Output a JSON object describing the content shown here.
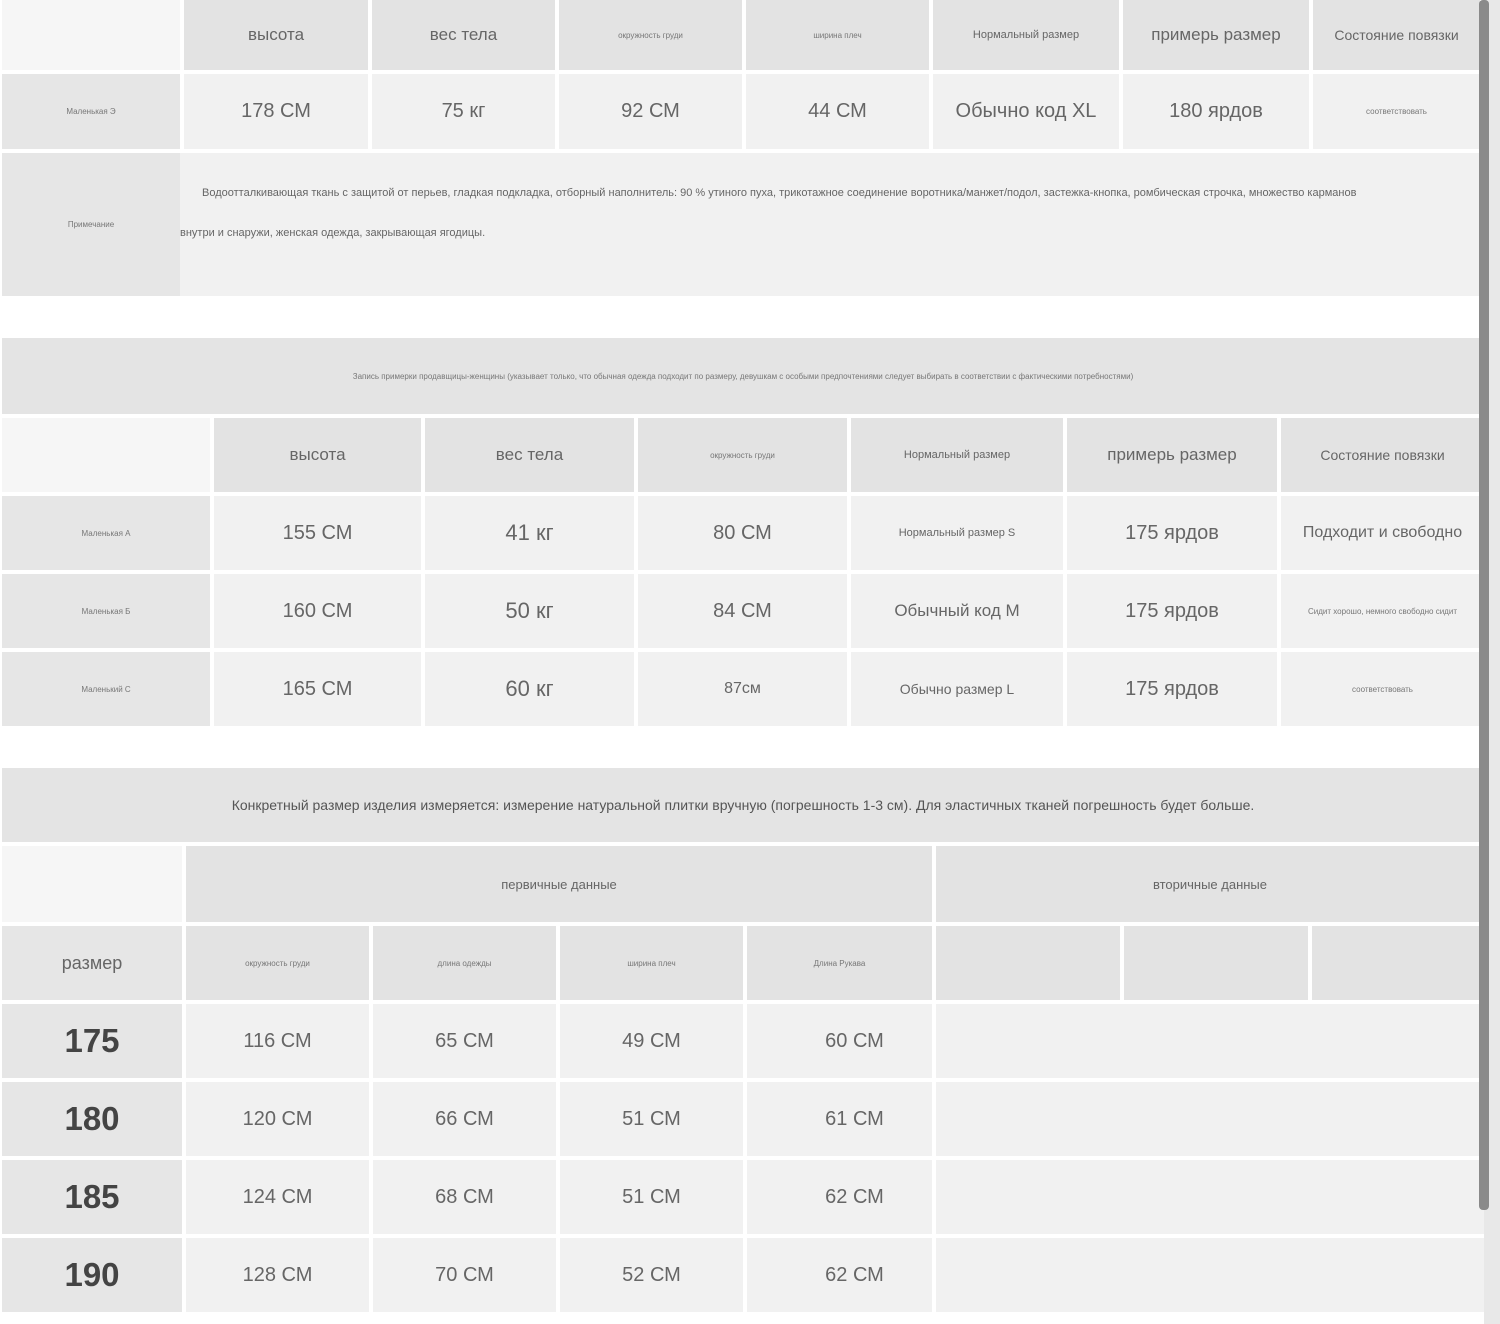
{
  "table1": {
    "headers": [
      "высота",
      "вес тела",
      "окружность груди",
      "ширина плеч",
      "Нормальный размер",
      "примерь размер",
      "Состояние повязки"
    ],
    "row": {
      "label": "Маленькая Э",
      "values": [
        "178 СМ",
        "75 кг",
        "92 СМ",
        "44 СМ",
        "Обычно код XL",
        "180 ярдов",
        "соответствовать"
      ]
    },
    "note_label": "Примечание",
    "note_text": "Водоотталкивающая ткань с защитой от перьев, гладкая подкладка, отборный наполнитель: 90 % утиного пуха, трикотажное соединение воротника/манжет/подол, застежка-кнопка, ромбическая строчка, множество карманов внутри и снаружи, женская одежда, закрывающая ягодицы."
  },
  "table2": {
    "title": "Запись примерки продавщицы-женщины (указывает только, что обычная одежда подходит по размеру, девушкам с особыми предпочтениями следует выбирать в соответствии с фактическими потребностями)",
    "headers": [
      "высота",
      "вес тела",
      "окружность груди",
      "Нормальный размер",
      "примерь размер",
      "Состояние повязки"
    ],
    "rows": [
      {
        "label": "Маленькая А",
        "values": [
          "155 СМ",
          "41 кг",
          "80 СМ",
          "Нормальный размер S",
          "175 ярдов",
          "Подходит и свободно"
        ]
      },
      {
        "label": "Маленькая Б",
        "values": [
          "160 СМ",
          "50 кг",
          "84 СМ",
          "Обычный код М",
          "175 ярдов",
          "Сидит хорошо, немного свободно сидит"
        ]
      },
      {
        "label": "Маленький С",
        "values": [
          "165 СМ",
          "60 кг",
          "87см",
          "Обычно размер L",
          "175 ярдов",
          "соответствовать"
        ]
      }
    ]
  },
  "table3": {
    "title": "Конкретный размер изделия измеряется: измерение натуральной плитки вручную (погрешность 1-3 см). Для эластичных тканей погрешность будет больше.",
    "primary_label": "первичные данные",
    "secondary_label": "вторичные данные",
    "size_label": "размер",
    "headers": [
      "окружность груди",
      "длина одежды",
      "ширина плеч",
      "Длина Рукава"
    ],
    "rows": [
      {
        "size": "175",
        "values": [
          "116 СМ",
          "65 СМ",
          "49 СМ",
          "60 СМ"
        ]
      },
      {
        "size": "180",
        "values": [
          "120 СМ",
          "66 СМ",
          "51 СМ",
          "61 СМ"
        ]
      },
      {
        "size": "185",
        "values": [
          "124 СМ",
          "68 СМ",
          "51 СМ",
          "62 СМ"
        ]
      },
      {
        "size": "190",
        "values": [
          "128 СМ",
          "70 СМ",
          "52 СМ",
          "62 СМ"
        ]
      }
    ]
  }
}
